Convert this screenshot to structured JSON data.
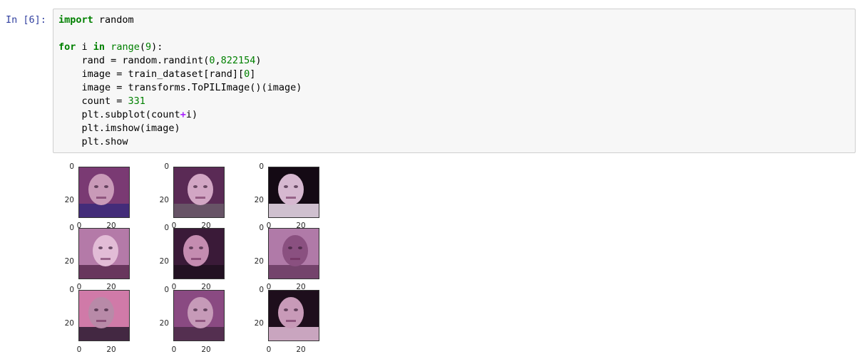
{
  "prompt_label": "In [6]:",
  "code_lines": [
    [
      {
        "t": "import",
        "c": "kw"
      },
      {
        "t": " random",
        "c": ""
      }
    ],
    [
      {
        "t": "",
        "c": ""
      }
    ],
    [
      {
        "t": "for",
        "c": "kw"
      },
      {
        "t": " i ",
        "c": ""
      },
      {
        "t": "in",
        "c": "kw"
      },
      {
        "t": " ",
        "c": ""
      },
      {
        "t": "range",
        "c": "bi"
      },
      {
        "t": "(",
        "c": ""
      },
      {
        "t": "9",
        "c": "num"
      },
      {
        "t": "):",
        "c": ""
      }
    ],
    [
      {
        "t": "    rand = random.randint(",
        "c": ""
      },
      {
        "t": "0",
        "c": "num"
      },
      {
        "t": ",",
        "c": ""
      },
      {
        "t": "822154",
        "c": "num"
      },
      {
        "t": ")",
        "c": ""
      }
    ],
    [
      {
        "t": "    image = train_dataset[rand][",
        "c": ""
      },
      {
        "t": "0",
        "c": "num"
      },
      {
        "t": "]",
        "c": ""
      }
    ],
    [
      {
        "t": "    image = transforms.ToPILImage()(image)",
        "c": ""
      }
    ],
    [
      {
        "t": "    count = ",
        "c": ""
      },
      {
        "t": "331",
        "c": "num"
      }
    ],
    [
      {
        "t": "    plt.subplot(count",
        "c": ""
      },
      {
        "t": "+",
        "c": "op"
      },
      {
        "t": "i)",
        "c": ""
      }
    ],
    [
      {
        "t": "    plt.imshow(image)",
        "c": ""
      }
    ],
    [
      {
        "t": "    plt.show",
        "c": ""
      }
    ]
  ],
  "output": {
    "y_ticks": [
      "0",
      "20"
    ],
    "x_ticks": [
      "0",
      "20"
    ],
    "images": [
      {
        "subject": "face-photo",
        "bg": "#7a3a73",
        "face": "#c99ab8",
        "accent": "#3a2a7a"
      },
      {
        "subject": "face-photo",
        "bg": "#5a2a55",
        "face": "#d2a6c4",
        "accent": "#6a5a6a"
      },
      {
        "subject": "face-photo",
        "bg": "#140a14",
        "face": "#d6b8d0",
        "accent": "#f0e0f0"
      },
      {
        "subject": "face-photo",
        "bg": "#b47aa8",
        "face": "#e2bcd6",
        "accent": "#5a2a50"
      },
      {
        "subject": "face-photo",
        "bg": "#3a1a38",
        "face": "#c48cb0",
        "accent": "#1e101e"
      },
      {
        "subject": "face-photo",
        "bg": "#b07aa8",
        "face": "#8a5080",
        "accent": "#6a3a62"
      },
      {
        "subject": "face-photo",
        "bg": "#d07aa8",
        "face": "#b88aa8",
        "accent": "#2a1a30"
      },
      {
        "subject": "face-photo",
        "bg": "#8a4a82",
        "face": "#c69ab8",
        "accent": "#4a2a48"
      },
      {
        "subject": "face-photo",
        "bg": "#1e0e1c",
        "face": "#c89ab8",
        "accent": "#e8c0dc"
      }
    ]
  }
}
